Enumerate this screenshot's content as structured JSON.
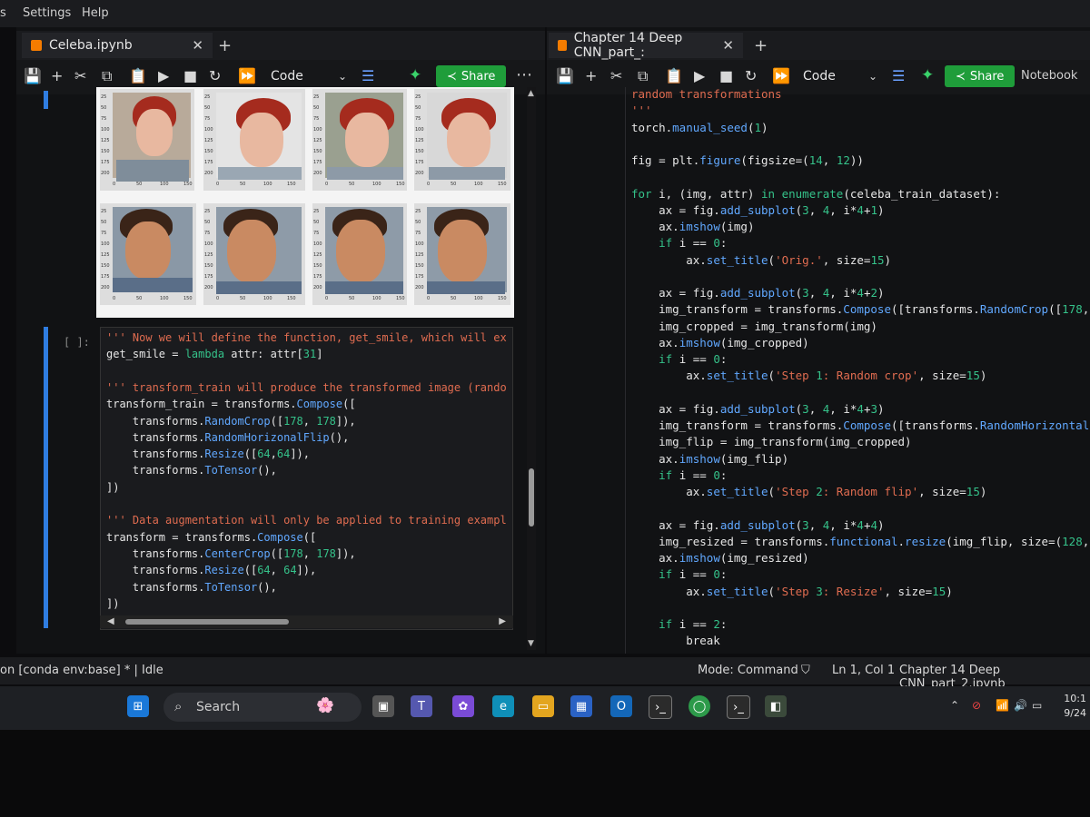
{
  "menu": {
    "item0": "s",
    "item1": "Settings",
    "item2": "Help"
  },
  "left": {
    "tab_title": "Celeba.ipynb",
    "cell_type": "Code",
    "share_label": "Share",
    "input_prompt": "[ ]:",
    "code_lines": [
      {
        "s": "''' Now we will define the function, get_smile, which will ex",
        "c": "str"
      },
      {
        "s": "get_smile = lambda attr: attr[31]",
        "c": "plain"
      },
      {
        "s": "",
        "c": "plain"
      },
      {
        "s": "''' transform_train will produce the transformed image (rando",
        "c": "str"
      },
      {
        "s": "transform_train = transforms.Compose([",
        "c": "plain"
      },
      {
        "s": "    transforms.RandomCrop([178, 178]),",
        "c": "plain"
      },
      {
        "s": "    transforms.RandomHorizonalFlip(),",
        "c": "plain"
      },
      {
        "s": "    transforms.Resize([64,64]),",
        "c": "plain"
      },
      {
        "s": "    transforms.ToTensor(),",
        "c": "plain"
      },
      {
        "s": "])",
        "c": "plain"
      },
      {
        "s": "",
        "c": "plain"
      },
      {
        "s": "''' Data augmentation will only be applied to training exampl",
        "c": "str"
      },
      {
        "s": "transform = transforms.Compose([",
        "c": "plain"
      },
      {
        "s": "    transforms.CenterCrop([178, 178]),",
        "c": "plain"
      },
      {
        "s": "    transforms.Resize([64, 64]),",
        "c": "plain"
      },
      {
        "s": "    transforms.ToTensor(),",
        "c": "plain"
      },
      {
        "s": "])",
        "c": "plain"
      }
    ],
    "axis_ticks_row1": [
      "25",
      "50",
      "75",
      "100",
      "125",
      "150",
      "175",
      "200"
    ],
    "axis_xticks": [
      "0",
      "50",
      "100",
      "150"
    ]
  },
  "right": {
    "tab_title": "Chapter 14 Deep CNN_part_:",
    "cell_type": "Code",
    "share_label": "Share",
    "notebook_label": "Notebook",
    "code_lines": [
      {
        "s": "random transformations",
        "c": "str"
      },
      {
        "s": "'''",
        "c": "str"
      },
      {
        "s": "torch.manual_seed(1)",
        "c": "plain"
      },
      {
        "s": "",
        "c": "plain"
      },
      {
        "s": "fig = plt.figure(figsize=(14, 12))",
        "c": "plain"
      },
      {
        "s": "",
        "c": "plain"
      },
      {
        "s": "for i, (img, attr) in enumerate(celeba_train_dataset):",
        "c": "plain"
      },
      {
        "s": "    ax = fig.add_subplot(3, 4, i*4+1)",
        "c": "plain"
      },
      {
        "s": "    ax.imshow(img)",
        "c": "plain"
      },
      {
        "s": "    if i == 0:",
        "c": "plain"
      },
      {
        "s": "        ax.set_title('Orig.', size=15)",
        "c": "plain"
      },
      {
        "s": "",
        "c": "plain"
      },
      {
        "s": "    ax = fig.add_subplot(3, 4, i*4+2)",
        "c": "plain"
      },
      {
        "s": "    img_transform = transforms.Compose([transforms.RandomCrop([178, 178",
        "c": "plain"
      },
      {
        "s": "    img_cropped = img_transform(img)",
        "c": "plain"
      },
      {
        "s": "    ax.imshow(img_cropped)",
        "c": "plain"
      },
      {
        "s": "    if i == 0:",
        "c": "plain"
      },
      {
        "s": "        ax.set_title('Step 1: Random crop', size=15)",
        "c": "plain"
      },
      {
        "s": "",
        "c": "plain"
      },
      {
        "s": "    ax = fig.add_subplot(3, 4, i*4+3)",
        "c": "plain"
      },
      {
        "s": "    img_transform = transforms.Compose([transforms.RandomHorizontalFlip",
        "c": "plain"
      },
      {
        "s": "    img_flip = img_transform(img_cropped)",
        "c": "plain"
      },
      {
        "s": "    ax.imshow(img_flip)",
        "c": "plain"
      },
      {
        "s": "    if i == 0:",
        "c": "plain"
      },
      {
        "s": "        ax.set_title('Step 2: Random flip', size=15)",
        "c": "plain"
      },
      {
        "s": "",
        "c": "plain"
      },
      {
        "s": "    ax = fig.add_subplot(3, 4, i*4+4)",
        "c": "plain"
      },
      {
        "s": "    img_resized = transforms.functional.resize(img_flip, size=(128, 128",
        "c": "plain"
      },
      {
        "s": "    ax.imshow(img_resized)",
        "c": "plain"
      },
      {
        "s": "    if i == 0:",
        "c": "plain"
      },
      {
        "s": "        ax.set_title('Step 3: Resize', size=15)",
        "c": "plain"
      },
      {
        "s": "",
        "c": "plain"
      },
      {
        "s": "    if i == 2:",
        "c": "plain"
      },
      {
        "s": "        break",
        "c": "plain"
      }
    ]
  },
  "status": {
    "kernel": "on [conda env:base] * | Idle",
    "mode": "Mode: Command",
    "cursor": "Ln 1, Col 1",
    "file": "Chapter 14 Deep CNN_part_2.ipynb"
  },
  "taskbar": {
    "search_label": "Search",
    "time": "10:1",
    "date": "9/24"
  },
  "colors": {
    "share_green": "#1f9d3a",
    "cell_bar": "#2f7de1",
    "string": "#e06c50",
    "function": "#61a8ff",
    "keyword": "#35c28a"
  }
}
